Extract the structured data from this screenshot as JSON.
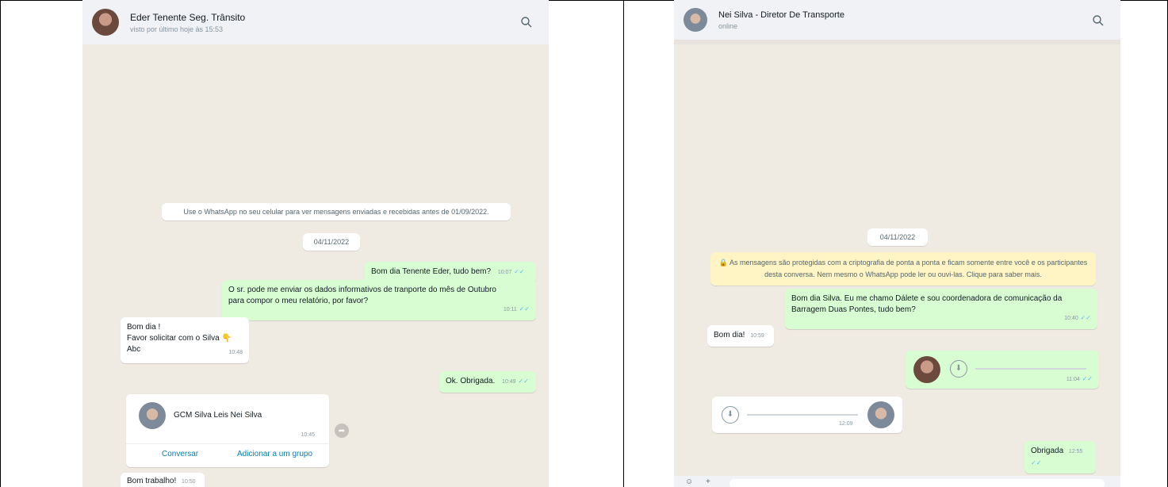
{
  "colors": {
    "chat_bg": "#efeae2",
    "outgoing_bubble": "#d9fdd3",
    "incoming_bubble": "#ffffff",
    "header_bg": "#f0f2f5",
    "ticks": "#53bdeb",
    "encryption_notice": "#fff5c4",
    "link": "#027eb5"
  },
  "left_chat": {
    "header": {
      "name": "Eder Tenente Seg. Trânsito",
      "status": "visto por último hoje às 15:53",
      "search_icon": "search-icon"
    },
    "system_notice": "Use o WhatsApp no seu celular para ver mensagens enviadas e recebidas antes de 01/09/2022.",
    "date_chip": "04/11/2022",
    "messages": [
      {
        "text": "Bom dia Tenente Eder, tudo bem?",
        "time": "10:07"
      },
      {
        "text_line1": "O sr. pode me enviar os dados informativos de tranporte do mês de Outubro",
        "text_line2": "para compor o meu relatório, por favor?",
        "time": "10:11"
      },
      {
        "line1": "Bom dia !",
        "line2": "Favor solicitar com o Silva",
        "emoji": "👇",
        "line3": "Abc",
        "time": "10:48"
      },
      {
        "text": "Ok. Obrigada.",
        "time": "10:49"
      },
      {
        "text": "Bom trabalho!",
        "time": "10:50"
      }
    ],
    "contact_card": {
      "name": "GCM Silva Leis Nei Silva",
      "time": "10:45",
      "action_chat": "Conversar",
      "action_group": "Adicionar a um grupo"
    }
  },
  "right_chat": {
    "header": {
      "name": "Nei Silva - Diretor De Transporte",
      "status": "online",
      "search_icon": "search-icon"
    },
    "date_chip": "04/11/2022",
    "encryption_line1": "As mensagens são protegidas com a criptografia de ponta a ponta e ficam somente entre você e os participantes",
    "encryption_line2": "desta conversa. Nem mesmo o WhatsApp pode ler ou ouvi-las. Clique para saber mais.",
    "messages": [
      {
        "line1": "Bom dia Silva. Eu me chamo Dálete e sou coordenadora de comunicação da",
        "line2": "Barragem Duas Pontes, tudo bem?",
        "time": "10:40"
      },
      {
        "text": "Bom dia!",
        "time": "10:59"
      },
      {
        "time": "11:04"
      },
      {
        "time": "12:09"
      },
      {
        "text": "Obrigada",
        "time": "12:55"
      }
    ]
  }
}
